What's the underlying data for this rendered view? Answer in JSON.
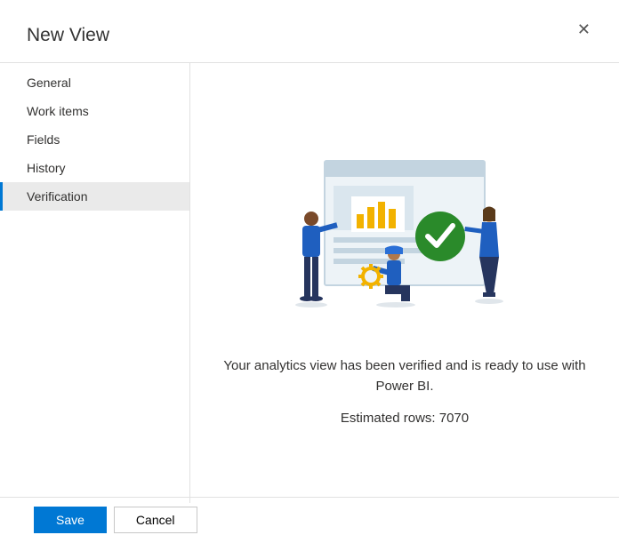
{
  "header": {
    "title": "New View"
  },
  "sidebar": {
    "items": [
      {
        "label": "General",
        "active": false
      },
      {
        "label": "Work items",
        "active": false
      },
      {
        "label": "Fields",
        "active": false
      },
      {
        "label": "History",
        "active": false
      },
      {
        "label": "Verification",
        "active": true
      }
    ]
  },
  "content": {
    "verification_message": "Your analytics view has been verified and is ready to use with Power BI.",
    "estimated_rows_label": "Estimated rows: 7070"
  },
  "footer": {
    "save_label": "Save",
    "cancel_label": "Cancel"
  }
}
